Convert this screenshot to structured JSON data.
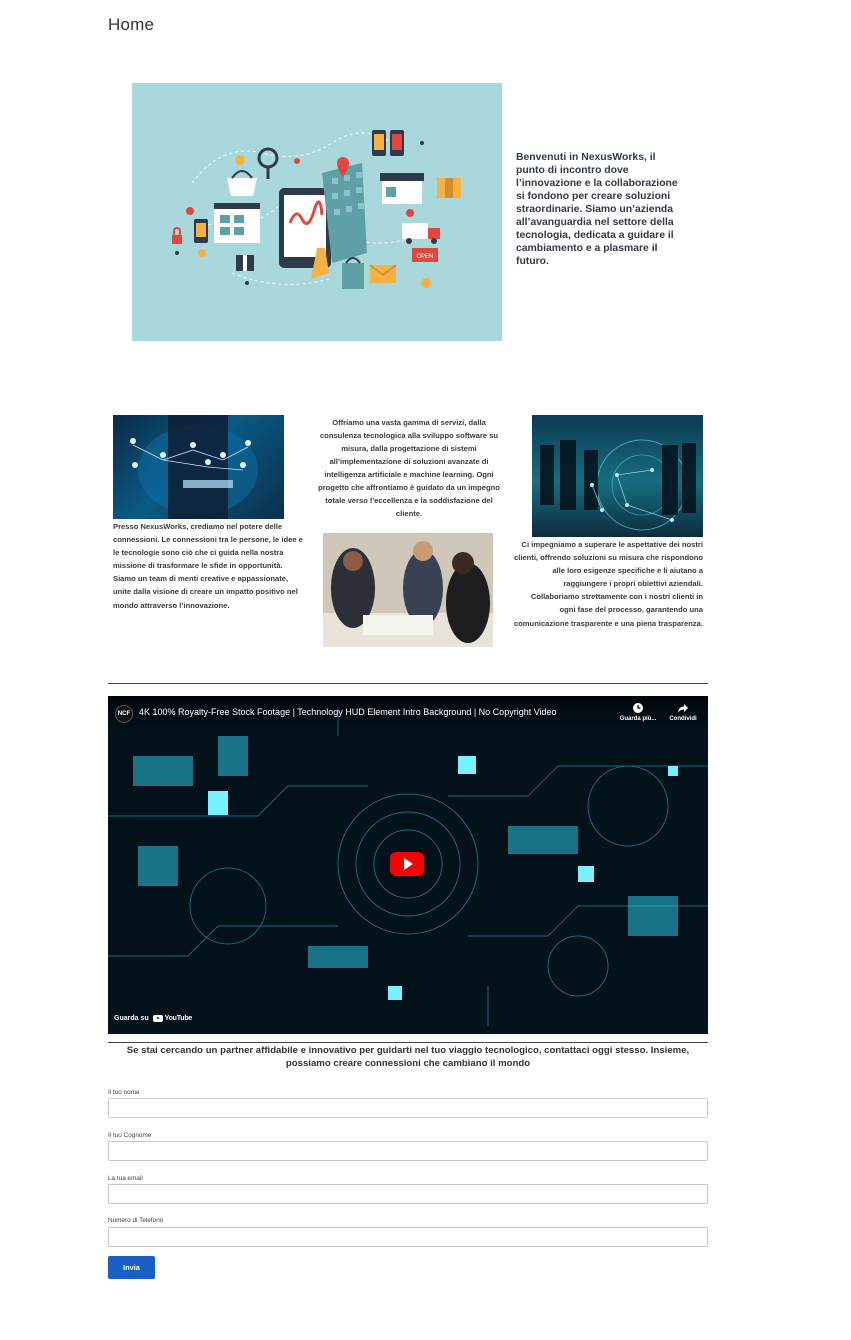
{
  "page": {
    "title": "Home"
  },
  "hero": {
    "text": "Benvenuti in NexusWorks, il punto di incontro dove l’innovazione e la collaborazione si fondono per creare soluzioni straordinarie. Siamo un’azienda all’avanguardia nel settore della tecnologia, dedicata a guidare il cambiamento e a plasmare il futuro.",
    "sign_text": "OPEN"
  },
  "columns": {
    "col1_text": "Presso NexusWorks, crediamo nel potere delle connessioni. Le connessioni tra le persone, le idee e le tecnologie sono ciò che ci guida nella nostra missione di trasformare le sfide in opportunità. Siamo un team di menti creative e appassionate, unite dalla visione di creare un impatto positivo nel mondo attraverso l’innovazione.",
    "col2_text": "Offriamo una vasta gamma di servizi, dalla consulenza tecnologica alla sviluppo software su misura, dalla progettazione di sistemi all’implementazione di soluzioni avanzate di intelligenza artificiale e machine learning. Ogni progetto che affrontiamo è guidato da un impegno totale verso l’eccellenza e la soddisfazione del cliente.",
    "col3_text": "Ci impegniamo a superare le aspettative dei nostri clienti, offrendo soluzioni su misura che rispondono alle loro esigenze specifiche e li aiutano a raggiungere i propri obiettivi aziendali. Collaboriamo strettamente con i nostri clienti in ogni fase del processo, garantendo una comunicazione trasparente e una piena trasparenza."
  },
  "video": {
    "channel": "NCF",
    "title": "4K 100% Royalty-Free Stock Footage | Technology HUD Element Intro Background | No Copyright Video",
    "watch_later": "Guarda più...",
    "share": "Condividi",
    "watch_on": "Guarda su",
    "youtube": "YouTube"
  },
  "cta": {
    "text": "Se stai cercando un partner affidabile e innovativo per guidarti nel tuo viaggio tecnologico, contattaci oggi stesso. Insieme, possiamo creare connessioni che cambiano il mondo"
  },
  "form": {
    "first_name_label": "Il tuo nome",
    "first_name_value": "",
    "last_name_label": "Il tuo Cognome",
    "last_name_value": "",
    "email_label": "La tua email",
    "email_value": "",
    "phone_label": "Numero di Telefono",
    "phone_value": "",
    "submit_label": "Invia"
  },
  "colors": {
    "accent": "#1a5fc6",
    "hero_bg": "#a9d8dc",
    "play_red": "#ff0000"
  }
}
